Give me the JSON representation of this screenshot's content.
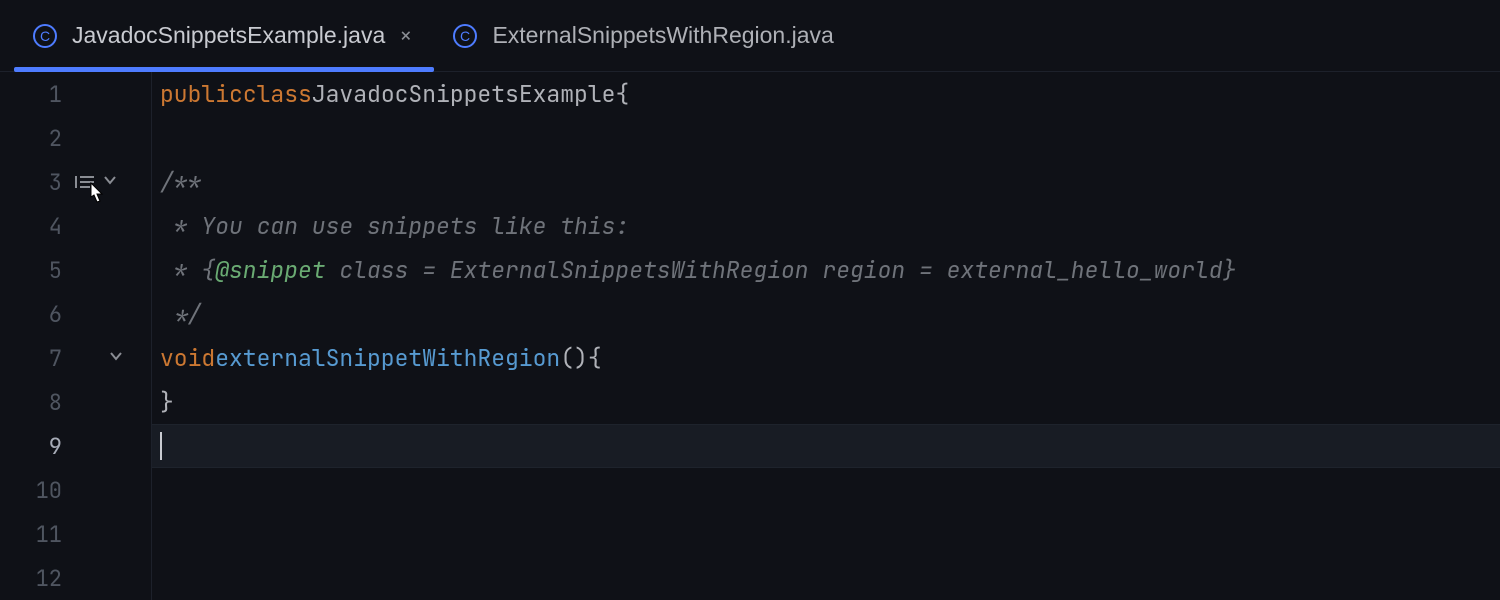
{
  "tabs": {
    "active": {
      "label": "JavadocSnippetsExample.java",
      "icon": "class-icon",
      "icon_letter": "C"
    },
    "inactive": {
      "label": "ExternalSnippetsWithRegion.java",
      "icon": "class-icon",
      "icon_letter": "C"
    }
  },
  "gutter": {
    "lines": [
      "1",
      "2",
      "3",
      "4",
      "5",
      "6",
      "7",
      "8",
      "9",
      "10",
      "11",
      "12"
    ],
    "fold_arrows": [
      3,
      7
    ],
    "doc_icon_line": 3,
    "active_line": 9
  },
  "code": {
    "l1": {
      "kw1": "public",
      "kw2": "class",
      "ident": "JavadocSnippetsExample",
      "brace": "{"
    },
    "l3": {
      "text": "/**"
    },
    "l4": {
      "text": " * You can use snippets like this:"
    },
    "l5": {
      "star": " * {",
      "tag": "@snippet",
      "rest": " class = ExternalSnippetsWithRegion region = external_hello_world}"
    },
    "l6": {
      "text": " */"
    },
    "l7": {
      "kw": "void",
      "method": "externalSnippetWithRegion",
      "parens": "()",
      "brace": "{"
    },
    "l8": {
      "brace": "}"
    }
  },
  "colors": {
    "accent": "#4e7cff",
    "icon_ring": "#4e7cff",
    "keyword": "#cc7832",
    "comment": "#6f737a",
    "doctag": "#6aab73",
    "method": "#579ad1"
  }
}
